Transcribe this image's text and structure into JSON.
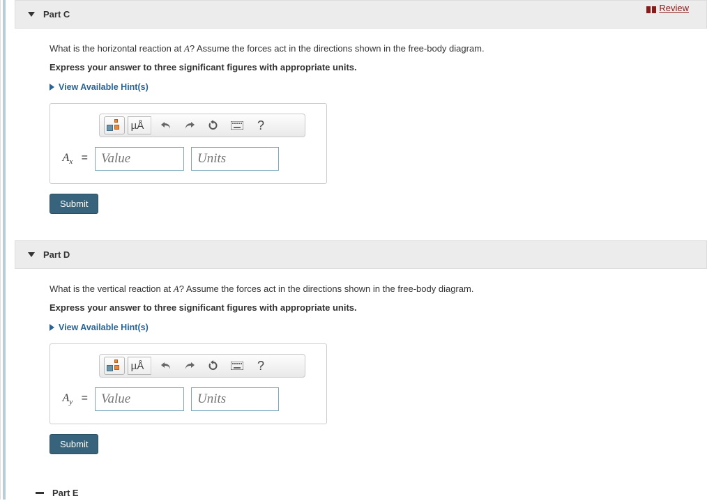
{
  "topbar": {
    "review_label": "Review"
  },
  "parts": {
    "c": {
      "title": "Part C",
      "question_prefix": "What is the horizontal reaction at ",
      "question_var": "A",
      "question_suffix": "? Assume the forces act in the directions shown in the free-body diagram.",
      "instruction": "Express your answer to three significant figures with appropriate units.",
      "hints_label": "View Available Hint(s)",
      "var_label_main": "A",
      "var_label_sub": "x",
      "equals": "=",
      "value_placeholder": "Value",
      "units_placeholder": "Units",
      "submit_label": "Submit",
      "help_symbol": "?"
    },
    "d": {
      "title": "Part D",
      "question_prefix": "What is the vertical reaction at ",
      "question_var": "A",
      "question_suffix": "? Assume the forces act in the directions shown in the free-body diagram.",
      "instruction": "Express your answer to three significant figures with appropriate units.",
      "hints_label": "View Available Hint(s)",
      "var_label_main": "A",
      "var_label_sub": "y",
      "equals": "=",
      "value_placeholder": "Value",
      "units_placeholder": "Units",
      "submit_label": "Submit",
      "help_symbol": "?"
    },
    "e": {
      "title": "Part E"
    }
  },
  "toolbar": {
    "mu_a_label": "µÅ"
  }
}
